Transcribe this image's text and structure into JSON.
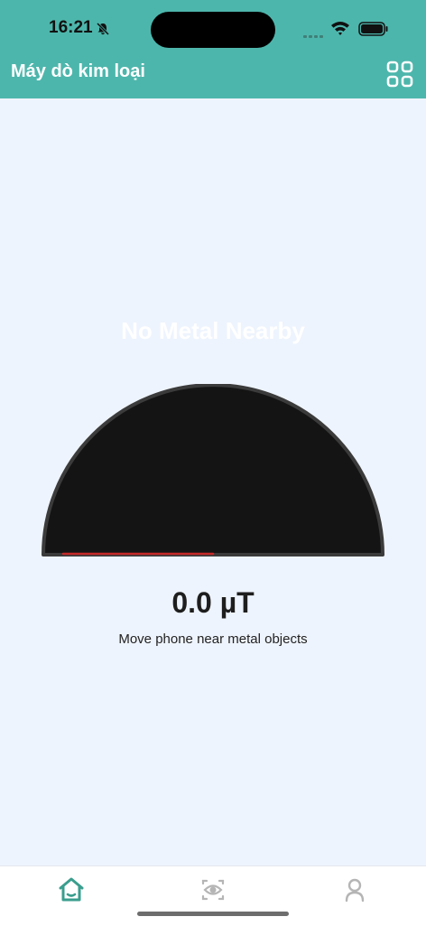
{
  "status_bar": {
    "time": "16:21"
  },
  "header": {
    "title": "Máy dò kim loại"
  },
  "detector": {
    "status": "No Metal Nearby",
    "reading": "0.0 µT",
    "hint": "Move phone near metal objects",
    "level": 0.0
  },
  "tabs": [
    {
      "name": "home",
      "active": true
    },
    {
      "name": "scanner",
      "active": false
    },
    {
      "name": "profile",
      "active": false
    }
  ],
  "colors": {
    "accent": "#4db6ac",
    "active_tab": "#3a9e8e",
    "inactive_tab": "#b5b5b5",
    "gauge_fill": "#141414",
    "gauge_needle": "#c62828",
    "background": "#eef4fd"
  }
}
